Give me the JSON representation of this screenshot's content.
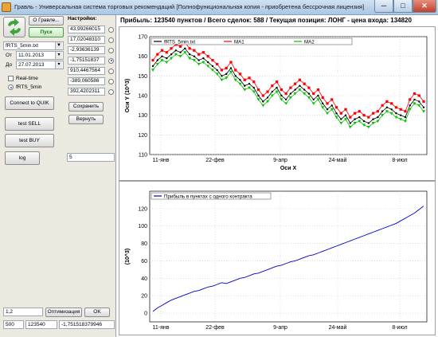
{
  "window": {
    "title": "Гравль - Универсальная система торговых рекомендаций [Полнофункциональная копия - приобретена бессрочная лицензия]",
    "min": "─",
    "max": "□",
    "close": "✕"
  },
  "left": {
    "about_button": "О Гравле...",
    "start_button": "Пуск",
    "file_select": "fRTS_5min.txt",
    "from_label": "От",
    "from_date": "11.01.2013",
    "to_label": "До",
    "to_date": "27.07.2013",
    "realtime_label": "Real-time",
    "source_label": "fRTS_5min",
    "connect_button": "Connect to QUIK",
    "sell_button": "test SELL",
    "buy_button": "test BUY",
    "log_button": "log",
    "log_value": "5",
    "bottom_field1": "1,2",
    "optimize_button": "Оптимизация",
    "ok_button": "OK",
    "bottom_field2": "500",
    "bottom_field3": "123540",
    "bottom_field4": "-1,751518379946"
  },
  "settings": {
    "header": "Настройки:",
    "values": [
      "43,99266015",
      "17,02048310",
      "-2,93636139",
      "-1,75151837",
      "910,4467564",
      "-389,060586",
      "392,4202311"
    ],
    "selected_index": 3,
    "save_button": "Сохранить",
    "restore_button": "Вернуть"
  },
  "header_text": "Прибыль: 123540 пунктов / Всего сделок: 588 /  Текущая позиция: ЛОНГ - цена входа: 134820",
  "colors": {
    "price": "#000000",
    "ma1": "#ff0000",
    "ma2": "#00c000",
    "profit": "#0000cc"
  },
  "chart_data": [
    {
      "type": "line",
      "legend_placement": "top-left",
      "xlabel": "Оси X",
      "ylabel": "Оси Y (10^3)",
      "ylim": [
        110,
        170
      ],
      "yticks": [
        110,
        120,
        130,
        140,
        150,
        160,
        170
      ],
      "xtick_labels": [
        "11-янв",
        "22-фев",
        "9-апр",
        "24-май",
        "8-июл"
      ],
      "series": [
        {
          "name": "fRTS_5min.txt",
          "values": [
            155,
            158,
            160,
            159,
            161,
            163,
            162,
            164,
            161,
            160,
            158,
            159,
            157,
            155,
            153,
            150,
            151,
            154,
            150,
            148,
            145,
            146,
            144,
            140,
            137,
            139,
            142,
            144,
            140,
            138,
            141,
            143,
            145,
            143,
            141,
            138,
            140,
            136,
            133,
            135,
            131,
            128,
            130,
            126,
            128,
            129,
            127,
            126,
            128,
            129,
            132,
            134,
            133,
            131,
            130,
            129,
            135,
            138,
            137,
            134
          ]
        },
        {
          "name": "MA1",
          "values": [
            158,
            161,
            163,
            162,
            164,
            166,
            165,
            167,
            164,
            163,
            161,
            162,
            160,
            158,
            156,
            153,
            154,
            157,
            153,
            151,
            148,
            149,
            147,
            143,
            140,
            142,
            145,
            147,
            143,
            141,
            144,
            146,
            148,
            146,
            144,
            141,
            143,
            139,
            136,
            138,
            134,
            131,
            133,
            129,
            131,
            132,
            130,
            129,
            131,
            132,
            135,
            137,
            136,
            134,
            133,
            132,
            138,
            141,
            140,
            137
          ]
        },
        {
          "name": "MA2",
          "values": [
            153,
            156,
            158,
            157,
            159,
            161,
            160,
            162,
            159,
            158,
            156,
            157,
            155,
            153,
            151,
            148,
            149,
            152,
            148,
            146,
            143,
            144,
            142,
            138,
            135,
            137,
            140,
            142,
            138,
            136,
            139,
            141,
            143,
            141,
            139,
            136,
            138,
            134,
            131,
            133,
            129,
            126,
            128,
            124,
            126,
            127,
            125,
            124,
            126,
            127,
            130,
            132,
            131,
            129,
            128,
            127,
            133,
            136,
            135,
            132
          ]
        }
      ]
    },
    {
      "type": "line",
      "legend_placement": "top-left",
      "ylabel": "(10^3)",
      "ylim": [
        -10,
        140
      ],
      "yticks": [
        0,
        20,
        40,
        60,
        80,
        100,
        120
      ],
      "xtick_labels": [
        "11-янв",
        "22-фев",
        "9-апр",
        "24-май",
        "8-июл"
      ],
      "series": [
        {
          "name": "Прибыль в пунктах с одного контракта",
          "values": [
            2,
            6,
            9,
            12,
            15,
            17,
            19,
            21,
            23,
            25,
            26,
            28,
            30,
            31,
            33,
            35,
            34,
            36,
            38,
            40,
            41,
            43,
            45,
            46,
            48,
            50,
            52,
            54,
            55,
            57,
            59,
            60,
            62,
            64,
            66,
            67,
            69,
            71,
            73,
            75,
            77,
            79,
            81,
            83,
            85,
            87,
            89,
            91,
            93,
            95,
            97,
            99,
            101,
            103,
            106,
            109,
            112,
            115,
            119,
            123
          ]
        }
      ]
    }
  ]
}
